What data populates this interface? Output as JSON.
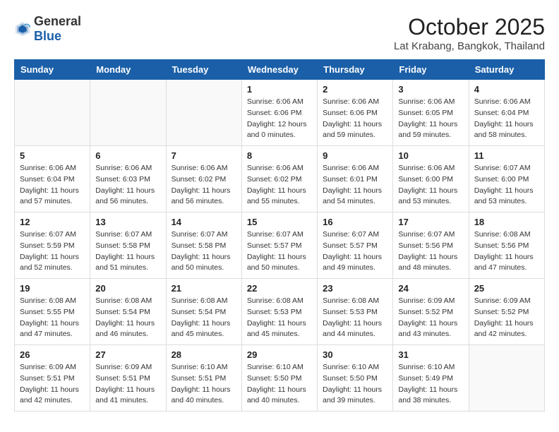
{
  "header": {
    "logo_general": "General",
    "logo_blue": "Blue",
    "month_year": "October 2025",
    "location": "Lat Krabang, Bangkok, Thailand"
  },
  "weekdays": [
    "Sunday",
    "Monday",
    "Tuesday",
    "Wednesday",
    "Thursday",
    "Friday",
    "Saturday"
  ],
  "weeks": [
    [
      {
        "day": "",
        "info": ""
      },
      {
        "day": "",
        "info": ""
      },
      {
        "day": "",
        "info": ""
      },
      {
        "day": "1",
        "info": "Sunrise: 6:06 AM\nSunset: 6:06 PM\nDaylight: 12 hours\nand 0 minutes."
      },
      {
        "day": "2",
        "info": "Sunrise: 6:06 AM\nSunset: 6:06 PM\nDaylight: 11 hours\nand 59 minutes."
      },
      {
        "day": "3",
        "info": "Sunrise: 6:06 AM\nSunset: 6:05 PM\nDaylight: 11 hours\nand 59 minutes."
      },
      {
        "day": "4",
        "info": "Sunrise: 6:06 AM\nSunset: 6:04 PM\nDaylight: 11 hours\nand 58 minutes."
      }
    ],
    [
      {
        "day": "5",
        "info": "Sunrise: 6:06 AM\nSunset: 6:04 PM\nDaylight: 11 hours\nand 57 minutes."
      },
      {
        "day": "6",
        "info": "Sunrise: 6:06 AM\nSunset: 6:03 PM\nDaylight: 11 hours\nand 56 minutes."
      },
      {
        "day": "7",
        "info": "Sunrise: 6:06 AM\nSunset: 6:02 PM\nDaylight: 11 hours\nand 56 minutes."
      },
      {
        "day": "8",
        "info": "Sunrise: 6:06 AM\nSunset: 6:02 PM\nDaylight: 11 hours\nand 55 minutes."
      },
      {
        "day": "9",
        "info": "Sunrise: 6:06 AM\nSunset: 6:01 PM\nDaylight: 11 hours\nand 54 minutes."
      },
      {
        "day": "10",
        "info": "Sunrise: 6:06 AM\nSunset: 6:00 PM\nDaylight: 11 hours\nand 53 minutes."
      },
      {
        "day": "11",
        "info": "Sunrise: 6:07 AM\nSunset: 6:00 PM\nDaylight: 11 hours\nand 53 minutes."
      }
    ],
    [
      {
        "day": "12",
        "info": "Sunrise: 6:07 AM\nSunset: 5:59 PM\nDaylight: 11 hours\nand 52 minutes."
      },
      {
        "day": "13",
        "info": "Sunrise: 6:07 AM\nSunset: 5:58 PM\nDaylight: 11 hours\nand 51 minutes."
      },
      {
        "day": "14",
        "info": "Sunrise: 6:07 AM\nSunset: 5:58 PM\nDaylight: 11 hours\nand 50 minutes."
      },
      {
        "day": "15",
        "info": "Sunrise: 6:07 AM\nSunset: 5:57 PM\nDaylight: 11 hours\nand 50 minutes."
      },
      {
        "day": "16",
        "info": "Sunrise: 6:07 AM\nSunset: 5:57 PM\nDaylight: 11 hours\nand 49 minutes."
      },
      {
        "day": "17",
        "info": "Sunrise: 6:07 AM\nSunset: 5:56 PM\nDaylight: 11 hours\nand 48 minutes."
      },
      {
        "day": "18",
        "info": "Sunrise: 6:08 AM\nSunset: 5:56 PM\nDaylight: 11 hours\nand 47 minutes."
      }
    ],
    [
      {
        "day": "19",
        "info": "Sunrise: 6:08 AM\nSunset: 5:55 PM\nDaylight: 11 hours\nand 47 minutes."
      },
      {
        "day": "20",
        "info": "Sunrise: 6:08 AM\nSunset: 5:54 PM\nDaylight: 11 hours\nand 46 minutes."
      },
      {
        "day": "21",
        "info": "Sunrise: 6:08 AM\nSunset: 5:54 PM\nDaylight: 11 hours\nand 45 minutes."
      },
      {
        "day": "22",
        "info": "Sunrise: 6:08 AM\nSunset: 5:53 PM\nDaylight: 11 hours\nand 45 minutes."
      },
      {
        "day": "23",
        "info": "Sunrise: 6:08 AM\nSunset: 5:53 PM\nDaylight: 11 hours\nand 44 minutes."
      },
      {
        "day": "24",
        "info": "Sunrise: 6:09 AM\nSunset: 5:52 PM\nDaylight: 11 hours\nand 43 minutes."
      },
      {
        "day": "25",
        "info": "Sunrise: 6:09 AM\nSunset: 5:52 PM\nDaylight: 11 hours\nand 42 minutes."
      }
    ],
    [
      {
        "day": "26",
        "info": "Sunrise: 6:09 AM\nSunset: 5:51 PM\nDaylight: 11 hours\nand 42 minutes."
      },
      {
        "day": "27",
        "info": "Sunrise: 6:09 AM\nSunset: 5:51 PM\nDaylight: 11 hours\nand 41 minutes."
      },
      {
        "day": "28",
        "info": "Sunrise: 6:10 AM\nSunset: 5:51 PM\nDaylight: 11 hours\nand 40 minutes."
      },
      {
        "day": "29",
        "info": "Sunrise: 6:10 AM\nSunset: 5:50 PM\nDaylight: 11 hours\nand 40 minutes."
      },
      {
        "day": "30",
        "info": "Sunrise: 6:10 AM\nSunset: 5:50 PM\nDaylight: 11 hours\nand 39 minutes."
      },
      {
        "day": "31",
        "info": "Sunrise: 6:10 AM\nSunset: 5:49 PM\nDaylight: 11 hours\nand 38 minutes."
      },
      {
        "day": "",
        "info": ""
      }
    ]
  ]
}
